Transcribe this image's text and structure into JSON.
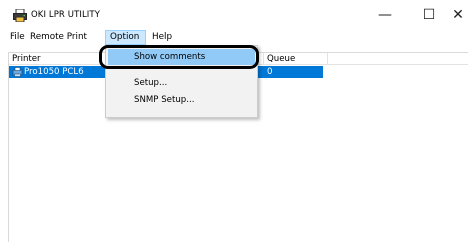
{
  "window": {
    "title": "OKI LPR UTILITY",
    "minimize_glyph": "—",
    "maximize_glyph": "☐",
    "close_glyph": "✕"
  },
  "menubar": {
    "file": "File",
    "remote_print": "Remote Print",
    "option": "Option",
    "help": "Help"
  },
  "list": {
    "columns": [
      "Printer",
      "Queue",
      ""
    ],
    "rows": [
      {
        "printer": "Pro1050 PCL6",
        "queue": "0",
        "selected": true
      }
    ]
  },
  "option_menu": {
    "items": [
      "Show comments",
      "Setup...",
      "SNMP Setup..."
    ],
    "highlighted": "Show comments"
  },
  "colors": {
    "selection": "#0078d7",
    "menu_hover": "#91c9f7",
    "menu_active": "#cce8ff"
  },
  "icons": {
    "app": "printer-icon",
    "row": "network-printer-icon"
  }
}
